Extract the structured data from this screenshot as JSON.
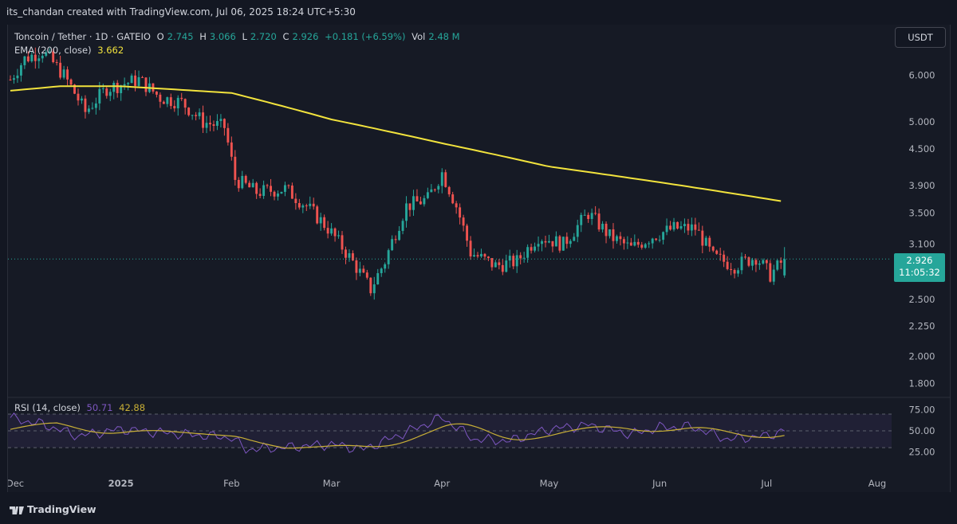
{
  "header": {
    "credit": "its_chandan created with TradingView.com, Jul 06, 2025 18:24 UTC+5:30"
  },
  "legend": {
    "symbol": "Toncoin / Tether · 1D · GATEIO",
    "o_label": "O",
    "o_value": "2.745",
    "h_label": "H",
    "h_value": "3.066",
    "l_label": "L",
    "l_value": "2.720",
    "c_label": "C",
    "c_value": "2.926",
    "change": "+0.181 (+6.59%)",
    "vol_label": "Vol",
    "vol_value": "2.48 M",
    "ema_label": "EMA (200, close)",
    "ema_value": "3.662",
    "rsi_label": "RSI (14, close)",
    "rsi_value": "50.71",
    "rsi_ma_value": "42.88"
  },
  "unit_button": "USDT",
  "price_tag": {
    "price": "2.926",
    "countdown": "11:05:32"
  },
  "footer": {
    "brand": "TradingView"
  },
  "colors": {
    "up": "#26a69a",
    "down": "#ef5350",
    "ema": "#f2e33d",
    "rsi": "#7e57c2",
    "rsi_ma": "#c9b036"
  },
  "chart_data": {
    "type": "candlestick",
    "price_axis": {
      "scale": "log",
      "ticks": [
        6.0,
        5.0,
        4.5,
        3.9,
        3.5,
        3.1,
        2.5,
        2.25,
        2.0,
        1.8
      ]
    },
    "price_tick_labels": [
      "6.000",
      "5.000",
      "4.500",
      "3.900",
      "3.500",
      "3.100",
      "2.500",
      "2.250",
      "2.000",
      "1.800"
    ],
    "rsi_axis": {
      "ticks": [
        75,
        50,
        25
      ],
      "labels": [
        "75.00",
        "50.00",
        "25.00"
      ],
      "band": [
        30,
        70
      ]
    },
    "time_axis": {
      "labels": [
        "Dec",
        "2025",
        "Feb",
        "Mar",
        "Apr",
        "May",
        "Jun",
        "Jul",
        "Aug"
      ],
      "dates": [
        "2024-12-01",
        "2025-01-01",
        "2025-02-01",
        "2025-03-01",
        "2025-04-01",
        "2025-05-01",
        "2025-06-01",
        "2025-07-01",
        "2025-08-01"
      ]
    },
    "close_keypoints": [
      [
        "2024-12-01",
        5.9
      ],
      [
        "2024-12-05",
        6.4
      ],
      [
        "2024-12-10",
        6.6
      ],
      [
        "2024-12-16",
        6.0
      ],
      [
        "2024-12-22",
        5.2
      ],
      [
        "2024-12-28",
        5.7
      ],
      [
        "2025-01-06",
        5.9
      ],
      [
        "2025-01-12",
        5.5
      ],
      [
        "2025-01-18",
        5.4
      ],
      [
        "2025-01-24",
        5.0
      ],
      [
        "2025-01-30",
        4.9
      ],
      [
        "2025-02-02",
        4.0
      ],
      [
        "2025-02-08",
        3.8
      ],
      [
        "2025-02-16",
        3.85
      ],
      [
        "2025-02-22",
        3.6
      ],
      [
        "2025-02-28",
        3.3
      ],
      [
        "2025-03-06",
        2.95
      ],
      [
        "2025-03-12",
        2.6
      ],
      [
        "2025-03-16",
        2.9
      ],
      [
        "2025-03-22",
        3.6
      ],
      [
        "2025-03-28",
        3.7
      ],
      [
        "2025-04-01",
        4.1
      ],
      [
        "2025-04-05",
        3.6
      ],
      [
        "2025-04-09",
        3.0
      ],
      [
        "2025-04-16",
        2.85
      ],
      [
        "2025-04-22",
        2.9
      ],
      [
        "2025-04-28",
        3.2
      ],
      [
        "2025-05-05",
        3.1
      ],
      [
        "2025-05-12",
        3.5
      ],
      [
        "2025-05-18",
        3.2
      ],
      [
        "2025-05-24",
        3.05
      ],
      [
        "2025-05-30",
        3.2
      ],
      [
        "2025-06-05",
        3.3
      ],
      [
        "2025-06-11",
        3.3
      ],
      [
        "2025-06-16",
        2.95
      ],
      [
        "2025-06-22",
        2.85
      ],
      [
        "2025-06-28",
        2.95
      ],
      [
        "2025-07-02",
        2.75
      ],
      [
        "2025-07-06",
        2.926
      ]
    ],
    "ema_keypoints": [
      [
        "2024-12-01",
        5.65
      ],
      [
        "2024-12-15",
        5.75
      ],
      [
        "2025-01-01",
        5.75
      ],
      [
        "2025-02-01",
        5.6
      ],
      [
        "2025-03-01",
        5.05
      ],
      [
        "2025-04-01",
        4.6
      ],
      [
        "2025-05-01",
        4.2
      ],
      [
        "2025-06-01",
        3.95
      ],
      [
        "2025-07-06",
        3.662
      ]
    ],
    "rsi_keypoints": [
      [
        "2024-12-01",
        65
      ],
      [
        "2024-12-10",
        58
      ],
      [
        "2024-12-20",
        44
      ],
      [
        "2025-01-01",
        52
      ],
      [
        "2025-01-15",
        47
      ],
      [
        "2025-02-01",
        42
      ],
      [
        "2025-02-05",
        28
      ],
      [
        "2025-02-15",
        30
      ],
      [
        "2025-03-01",
        34
      ],
      [
        "2025-03-10",
        28
      ],
      [
        "2025-03-20",
        45
      ],
      [
        "2025-04-01",
        66
      ],
      [
        "2025-04-10",
        40
      ],
      [
        "2025-04-20",
        38
      ],
      [
        "2025-05-01",
        52
      ],
      [
        "2025-05-12",
        57
      ],
      [
        "2025-05-24",
        46
      ],
      [
        "2025-06-01",
        54
      ],
      [
        "2025-06-10",
        55
      ],
      [
        "2025-06-20",
        40
      ],
      [
        "2025-07-01",
        44
      ],
      [
        "2025-07-06",
        50.71
      ]
    ]
  }
}
